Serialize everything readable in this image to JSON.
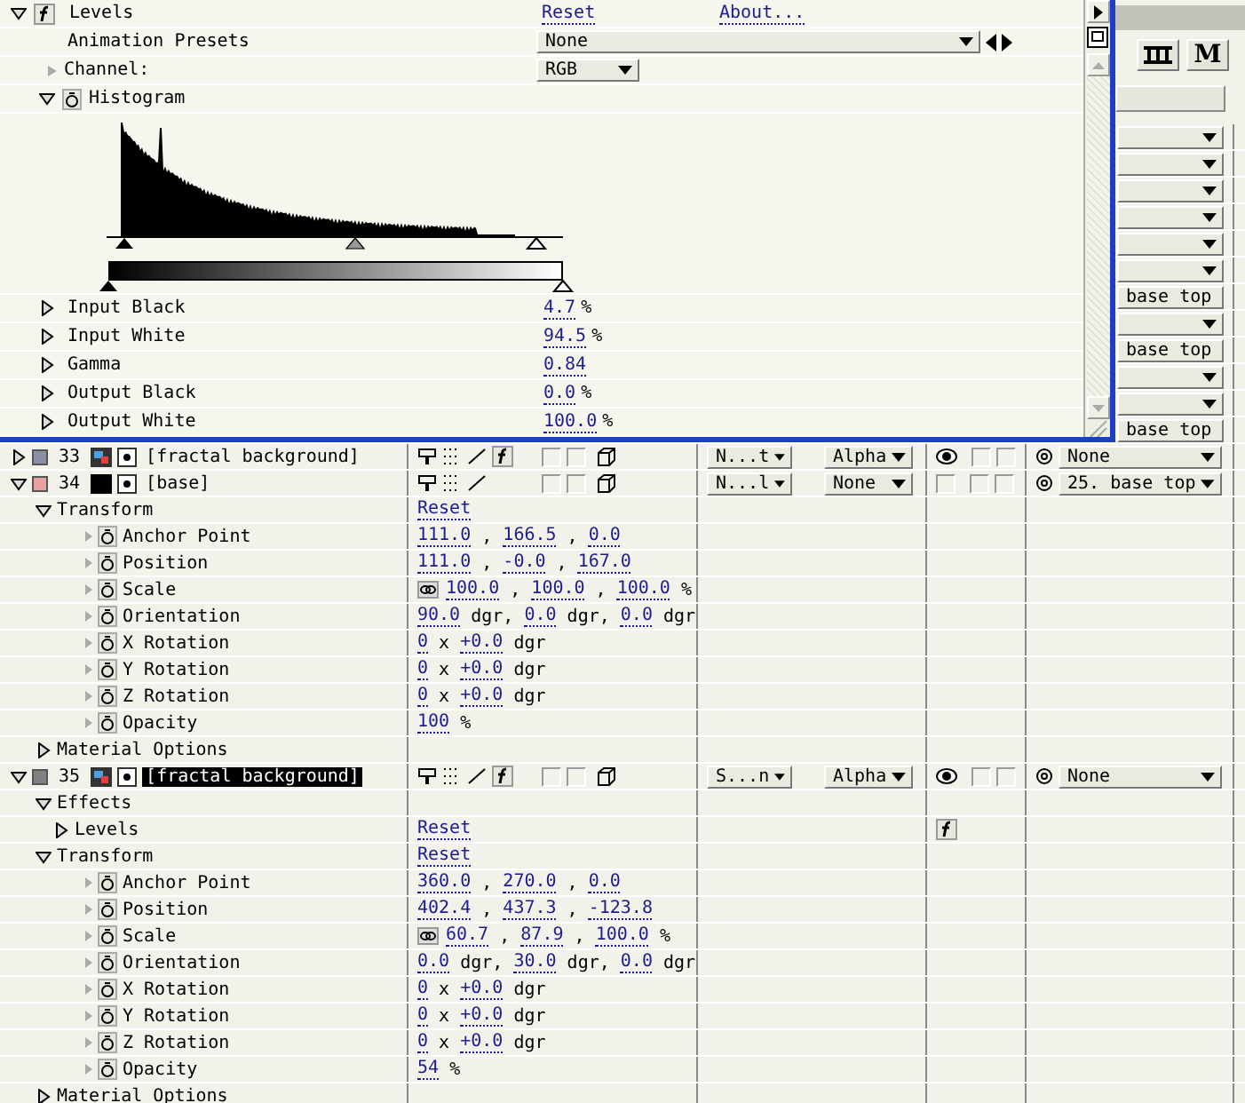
{
  "effect_panel": {
    "effect": {
      "name": "Levels",
      "expanded": true,
      "reset": "Reset",
      "about": "About..."
    },
    "presets": {
      "label": "Animation Presets",
      "value": "None"
    },
    "channel": {
      "label": "Channel:",
      "value": "RGB",
      "expanded": false
    },
    "histogram": {
      "label": "Histogram",
      "expanded": true
    },
    "params": [
      {
        "label": "Input Black",
        "value": "4.7",
        "unit": "%",
        "expanded": false
      },
      {
        "label": "Input White",
        "value": "94.5",
        "unit": "%",
        "expanded": false
      },
      {
        "label": "Gamma",
        "value": "0.84",
        "expanded": false
      },
      {
        "label": "Output Black",
        "value": "0.0",
        "unit": "%",
        "expanded": false
      },
      {
        "label": "Output White",
        "value": "100.0",
        "unit": "%",
        "expanded": false
      }
    ]
  },
  "timeline": {
    "toolbar": {
      "motion_blur": "M"
    },
    "parent_strip": [
      {
        "kind": "blank"
      },
      {
        "kind": "blank"
      },
      {
        "kind": "blank"
      },
      {
        "kind": "blank"
      },
      {
        "kind": "blank"
      },
      {
        "kind": "blank"
      },
      {
        "kind": "named",
        "text": "base top"
      },
      {
        "kind": "blank"
      },
      {
        "kind": "named",
        "text": "base top"
      },
      {
        "kind": "blank"
      },
      {
        "kind": "blank"
      },
      {
        "kind": "named",
        "text": "base top"
      }
    ],
    "layers": [
      {
        "number": "33",
        "name": "[fractal background]",
        "color": "#8890a8",
        "selected": false,
        "expanded": false,
        "kind": "comp",
        "effects": true,
        "mode": "N...t",
        "trkmat": "Alpha",
        "visible": true,
        "parent": "None"
      },
      {
        "number": "34",
        "name": "[base]",
        "color": "#e8a0a0",
        "selected": false,
        "expanded": true,
        "kind": "solid",
        "effects": false,
        "mode": "N...l",
        "trkmat": "None",
        "visible": false,
        "parent": "25. base top",
        "children": [
          {
            "kind": "group",
            "label": "Transform",
            "expanded": true,
            "reset": "Reset",
            "children": [
              {
                "kind": "property",
                "label": "Anchor Point",
                "parts": [
                  {
                    "text": "111.0",
                    "link": true
                  },
                  {
                    "text": " , "
                  },
                  {
                    "text": "166.5",
                    "link": true
                  },
                  {
                    "text": " , "
                  },
                  {
                    "text": "0.0",
                    "link": true
                  }
                ]
              },
              {
                "kind": "property",
                "label": "Position",
                "parts": [
                  {
                    "text": "111.0",
                    "link": true
                  },
                  {
                    "text": " , "
                  },
                  {
                    "text": "-0.0",
                    "link": true
                  },
                  {
                    "text": " , "
                  },
                  {
                    "text": "167.0",
                    "link": true
                  }
                ]
              },
              {
                "kind": "property",
                "label": "Scale",
                "chain": true,
                "parts": [
                  {
                    "text": "100.0",
                    "link": true
                  },
                  {
                    "text": " , "
                  },
                  {
                    "text": "100.0",
                    "link": true
                  },
                  {
                    "text": " , "
                  },
                  {
                    "text": "100.0",
                    "link": true
                  },
                  {
                    "text": " %"
                  }
                ]
              },
              {
                "kind": "property",
                "label": "Orientation",
                "parts": [
                  {
                    "text": "90.0",
                    "link": true
                  },
                  {
                    "text": " dgr, "
                  },
                  {
                    "text": "0.0",
                    "link": true
                  },
                  {
                    "text": " dgr, "
                  },
                  {
                    "text": "0.0",
                    "link": true
                  },
                  {
                    "text": " dgr"
                  }
                ]
              },
              {
                "kind": "property",
                "label": "X Rotation",
                "parts": [
                  {
                    "text": "0",
                    "link": true
                  },
                  {
                    "text": " x "
                  },
                  {
                    "text": "+0.0",
                    "link": true
                  },
                  {
                    "text": " dgr"
                  }
                ]
              },
              {
                "kind": "property",
                "label": "Y Rotation",
                "parts": [
                  {
                    "text": "0",
                    "link": true
                  },
                  {
                    "text": " x "
                  },
                  {
                    "text": "+0.0",
                    "link": true
                  },
                  {
                    "text": " dgr"
                  }
                ]
              },
              {
                "kind": "property",
                "label": "Z Rotation",
                "parts": [
                  {
                    "text": "0",
                    "link": true
                  },
                  {
                    "text": " x "
                  },
                  {
                    "text": "+0.0",
                    "link": true
                  },
                  {
                    "text": " dgr"
                  }
                ]
              },
              {
                "kind": "property",
                "label": "Opacity",
                "parts": [
                  {
                    "text": "100",
                    "link": true
                  },
                  {
                    "text": " %"
                  }
                ]
              }
            ]
          },
          {
            "kind": "group",
            "label": "Material Options",
            "expanded": false
          }
        ]
      },
      {
        "number": "35",
        "name": "[fractal background]",
        "color": "#808080",
        "selected": true,
        "expanded": true,
        "kind": "comp",
        "effects": true,
        "mode": "S...n",
        "trkmat": "Alpha",
        "visible": true,
        "parent": "None",
        "children": [
          {
            "kind": "group",
            "label": "Effects",
            "expanded": true,
            "children": [
              {
                "kind": "effect",
                "label": "Levels",
                "expanded": false,
                "reset": "Reset",
                "enabled": true
              }
            ]
          },
          {
            "kind": "group",
            "label": "Transform",
            "expanded": true,
            "reset": "Reset",
            "children": [
              {
                "kind": "property",
                "label": "Anchor Point",
                "parts": [
                  {
                    "text": "360.0",
                    "link": true
                  },
                  {
                    "text": " , "
                  },
                  {
                    "text": "270.0",
                    "link": true
                  },
                  {
                    "text": " , "
                  },
                  {
                    "text": "0.0",
                    "link": true
                  }
                ]
              },
              {
                "kind": "property",
                "label": "Position",
                "parts": [
                  {
                    "text": "402.4",
                    "link": true
                  },
                  {
                    "text": " , "
                  },
                  {
                    "text": "437.3",
                    "link": true
                  },
                  {
                    "text": " , "
                  },
                  {
                    "text": "-123.8",
                    "link": true
                  }
                ]
              },
              {
                "kind": "property",
                "label": "Scale",
                "chain": true,
                "parts": [
                  {
                    "text": "60.7",
                    "link": true
                  },
                  {
                    "text": " , "
                  },
                  {
                    "text": "87.9",
                    "link": true
                  },
                  {
                    "text": " , "
                  },
                  {
                    "text": "100.0",
                    "link": true
                  },
                  {
                    "text": " %"
                  }
                ]
              },
              {
                "kind": "property",
                "label": "Orientation",
                "parts": [
                  {
                    "text": "0.0",
                    "link": true
                  },
                  {
                    "text": " dgr, "
                  },
                  {
                    "text": "30.0",
                    "link": true
                  },
                  {
                    "text": " dgr, "
                  },
                  {
                    "text": "0.0",
                    "link": true
                  },
                  {
                    "text": " dgr"
                  }
                ]
              },
              {
                "kind": "property",
                "label": "X Rotation",
                "parts": [
                  {
                    "text": "0",
                    "link": true
                  },
                  {
                    "text": " x "
                  },
                  {
                    "text": "+0.0",
                    "link": true
                  },
                  {
                    "text": " dgr"
                  }
                ]
              },
              {
                "kind": "property",
                "label": "Y Rotation",
                "parts": [
                  {
                    "text": "0",
                    "link": true
                  },
                  {
                    "text": " x "
                  },
                  {
                    "text": "+0.0",
                    "link": true
                  },
                  {
                    "text": " dgr"
                  }
                ]
              },
              {
                "kind": "property",
                "label": "Z Rotation",
                "parts": [
                  {
                    "text": "0",
                    "link": true
                  },
                  {
                    "text": " x "
                  },
                  {
                    "text": "+0.0",
                    "link": true
                  },
                  {
                    "text": " dgr"
                  }
                ]
              },
              {
                "kind": "property",
                "label": "Opacity",
                "parts": [
                  {
                    "text": "54",
                    "link": true
                  },
                  {
                    "text": " %"
                  }
                ]
              }
            ]
          },
          {
            "kind": "group",
            "label": "Material Options",
            "expanded": false
          }
        ]
      }
    ]
  }
}
